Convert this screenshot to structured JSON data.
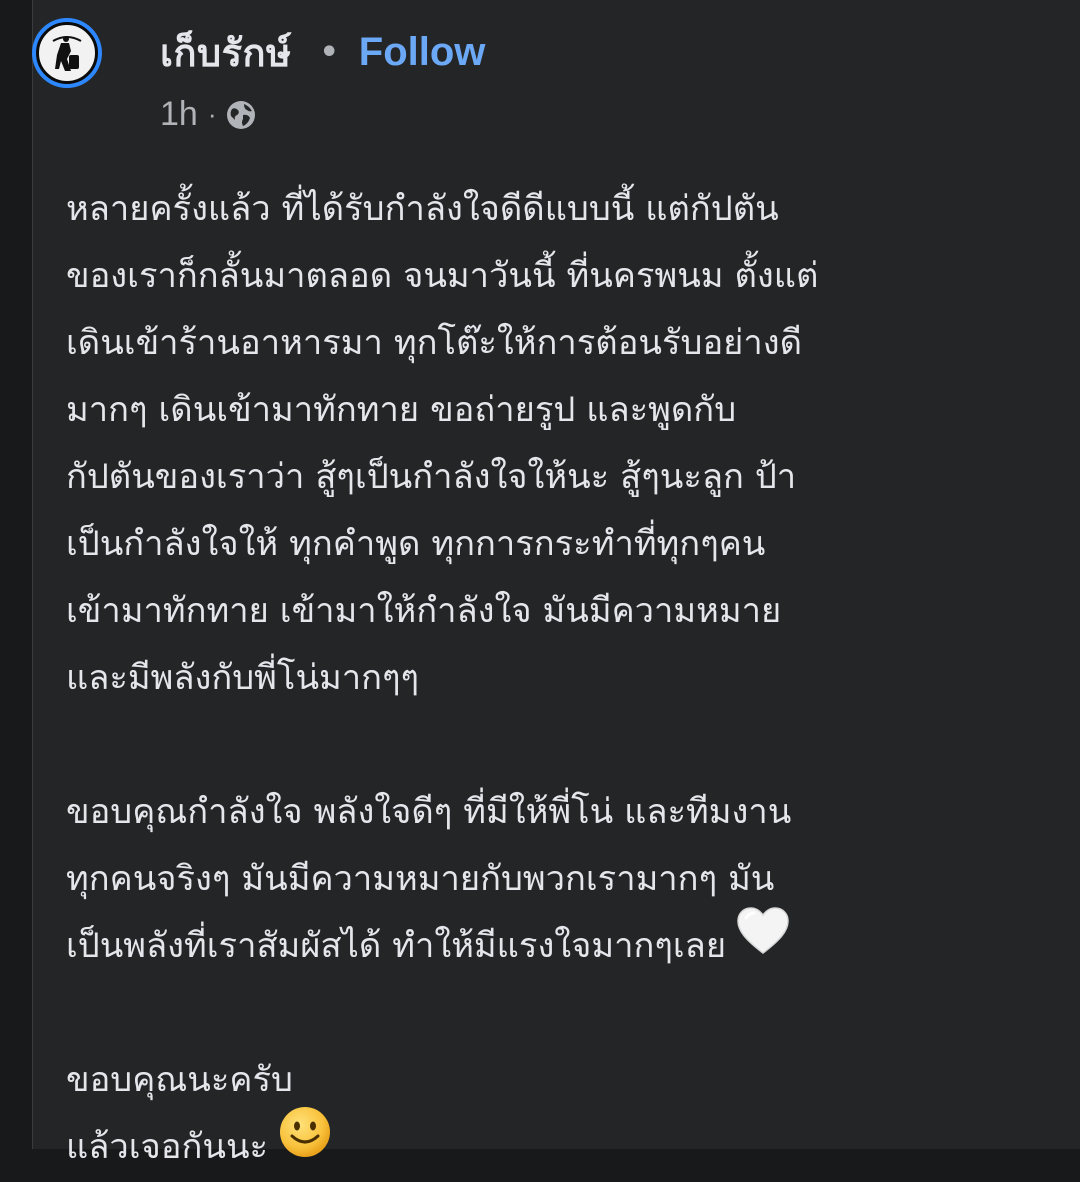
{
  "post": {
    "author": {
      "name": "เก็บรักษ์",
      "separator": "•",
      "follow_label": "Follow"
    },
    "meta": {
      "time": "1h",
      "dot": "·",
      "audience_icon": "globe-icon"
    },
    "body": {
      "paragraph1": [
        "หลายครั้งแล้ว ที่ได้รับกำลังใจดีดีแบบนี้ แต่กัปตัน",
        "ของเราก็กลั้นมาตลอด จนมาวันนี้ ที่นครพนม ตั้งแต่",
        "เดินเข้าร้านอาหารมา ทุกโต๊ะให้การต้อนรับอย่างดี",
        "มากๆ เดินเข้ามาทักทาย ขอถ่ายรูป และพูดกับ",
        "กัปตันของเราว่า สู้ๆเป็นกำลังใจให้นะ สู้ๆนะลูก ป้า",
        "เป็นกำลังใจให้ ทุกคำพูด ทุกการกระทำที่ทุกๆคน",
        "เข้ามาทักทาย เข้ามาให้กำลังใจ มันมีความหมาย",
        "และมีพลังกับพี่โน่มากๆๆ"
      ],
      "paragraph2": [
        "ขอบคุณกำลังใจ พลังใจดีๆ ที่มีให้พี่โน่ และทีมงาน",
        "ทุกคนจริงๆ มันมีความหมายกับพวกเรามากๆ มัน",
        "เป็นพลังที่เราสัมผัสได้ ทำให้มีแรงใจมากๆเลย"
      ],
      "paragraph3": [
        "ขอบคุณนะครับ",
        "แล้วเจอกันนะ"
      ],
      "emoji_heart": "white-heart-emoji",
      "emoji_smile": "smiling-face-emoji"
    }
  },
  "colors": {
    "background": "#242526",
    "text_primary": "#e4e6eb",
    "text_secondary": "#b0b3b8",
    "link": "#6ba8f5",
    "avatar_ring": "#2d88ff"
  }
}
